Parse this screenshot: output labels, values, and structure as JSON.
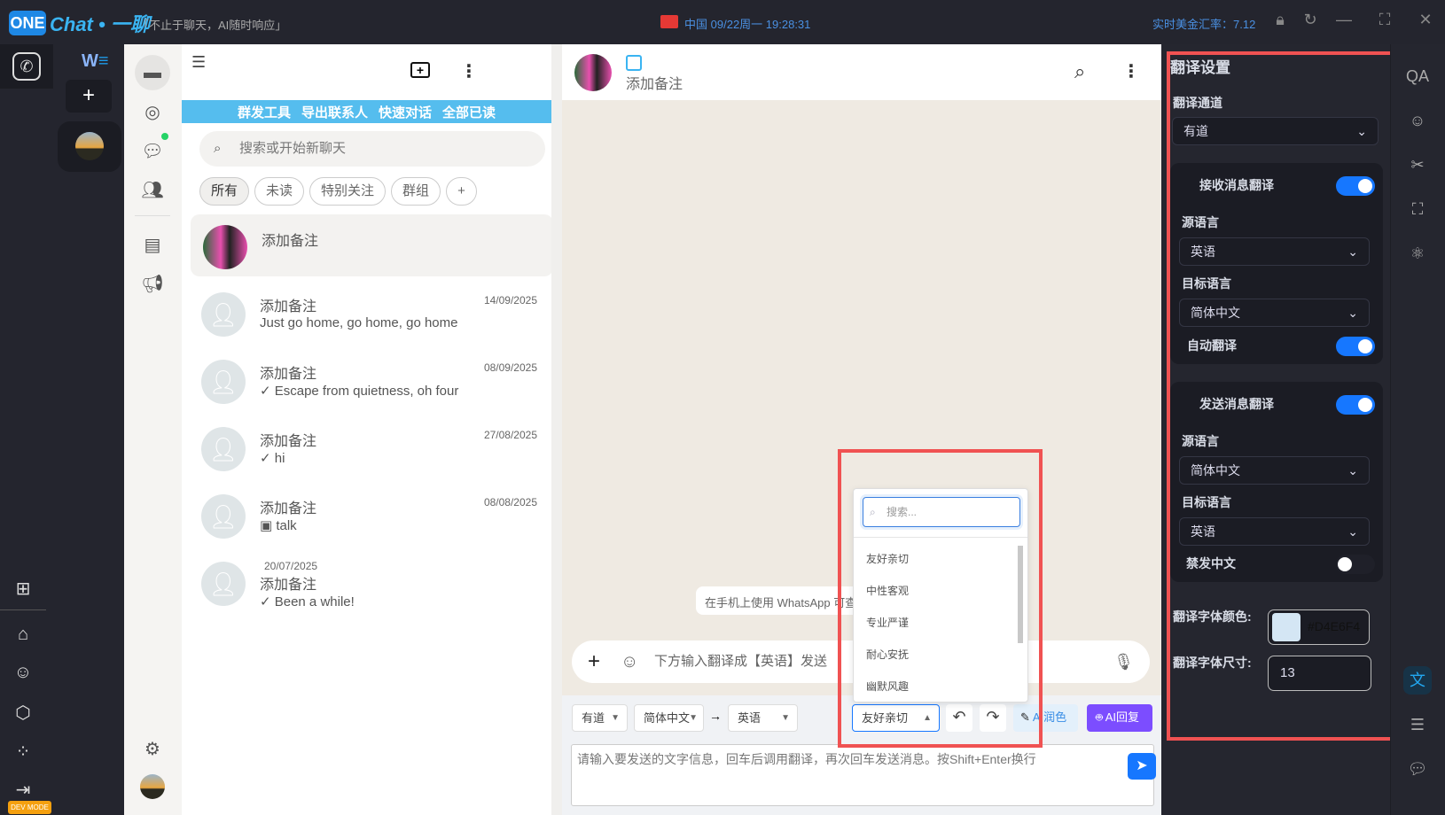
{
  "titlebar": {
    "logo_one": "ONE",
    "logo_chat": "Chat • 一聊",
    "slogan": "「不止于聊天，AI随时响应」",
    "country": "中国",
    "datetime": "09/22周一 19:28:31",
    "rate": "实时美金汇率：7.12"
  },
  "leftbar": {
    "w_logo": "W",
    "dev_mode": "DEV MODE"
  },
  "chatlist": {
    "tools": [
      "群发工具",
      "导出联系人",
      "快速对话",
      "全部已读"
    ],
    "search_placeholder": "搜索或开始新聊天",
    "filters": [
      "所有",
      "未读",
      "特别关注",
      "群组",
      "+"
    ],
    "chats": [
      {
        "name": "添加备注",
        "message": "",
        "date": ""
      },
      {
        "name": "添加备注",
        "message": "Just go home, go home, go home",
        "date": "14/09/2025"
      },
      {
        "name": "添加备注",
        "message": "✓ Escape from quietness, oh four",
        "date": "08/09/2025"
      },
      {
        "name": "添加备注",
        "message": "✓ hi",
        "date": "27/08/2025"
      },
      {
        "name": "添加备注",
        "message": "▣ talk",
        "date": "08/08/2025"
      },
      {
        "name": "添加备注",
        "message": "✓ Been a while!",
        "date": "20/07/2025"
      }
    ]
  },
  "chat": {
    "header_name": "添加备注",
    "system_notice": "在手机上使用 WhatsApp 可查",
    "composer_placeholder": "下方输入翻译成【英语】发送",
    "channel": "有道",
    "from_lang": "简体中文",
    "arrow": "→",
    "to_lang": "英语",
    "tone": "友好亲切",
    "ai_polish": "AI润色",
    "ai_reply": "AI回复",
    "textarea_placeholder": "请输入要发送的文字信息，回车后调用翻译，再次回车发送消息。按Shift+Enter换行",
    "tone_dropdown": {
      "search_placeholder": "搜索...",
      "options": [
        "友好亲切",
        "中性客观",
        "专业严谨",
        "耐心安抚",
        "幽默风趣"
      ]
    }
  },
  "translate": {
    "title": "翻译设置",
    "channel_label": "翻译通道",
    "channel": "有道",
    "receive": {
      "label": "接收消息翻译",
      "enabled": true,
      "src_label": "源语言",
      "src": "英语",
      "dst_label": "目标语言",
      "dst": "简体中文",
      "auto_label": "自动翻译",
      "auto": true
    },
    "send": {
      "label": "发送消息翻译",
      "enabled": true,
      "src_label": "源语言",
      "src": "简体中文",
      "dst_label": "目标语言",
      "dst": "英语",
      "block_label": "禁发中文",
      "block": false
    },
    "font_color_label": "翻译字体颜色:",
    "font_color": "#D4E6F4",
    "font_size_label": "翻译字体尺寸:",
    "font_size": "13"
  },
  "colors": {
    "accent": "#1677ff",
    "highlight": "#f05252",
    "banner": "#55bdee",
    "ai_reply": "#7c4dff"
  }
}
